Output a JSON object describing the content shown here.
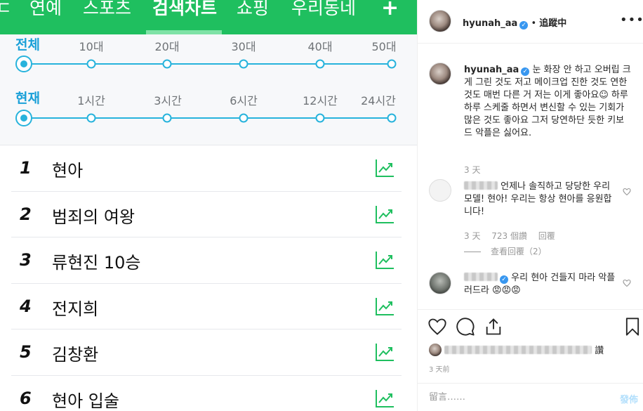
{
  "left": {
    "nav_tabs": [
      {
        "label": "ㄷ"
      },
      {
        "label": "연예"
      },
      {
        "label": "스포츠"
      },
      {
        "label": "검색차트"
      },
      {
        "label": "쇼핑"
      },
      {
        "label": "우리동네"
      },
      {
        "label": "+"
      }
    ],
    "age_filter": {
      "label": "전체",
      "options": [
        "10대",
        "20대",
        "30대",
        "40대",
        "50대"
      ]
    },
    "time_filter": {
      "label": "현재",
      "options": [
        "1시간",
        "3시간",
        "6시간",
        "12시간",
        "24시간"
      ]
    },
    "ranking": [
      {
        "rank": "1",
        "keyword": "현아"
      },
      {
        "rank": "2",
        "keyword": "범죄의 여왕"
      },
      {
        "rank": "3",
        "keyword": "류현진 10승"
      },
      {
        "rank": "4",
        "keyword": "전지희"
      },
      {
        "rank": "5",
        "keyword": "김창환"
      },
      {
        "rank": "6",
        "keyword": "현아 입술"
      }
    ],
    "colors": {
      "nav_green": "#1fbf5f",
      "accent_blue": "#27b3dc",
      "trend_green": "#1fbf5f"
    }
  },
  "post": {
    "username": "hyunah_aa",
    "follow_label": "追蹤中",
    "separator": "•",
    "caption": "눈 화장 안 하고 오버립 크게 그린 것도 저고 메이크업 진한 것도 연한 것도 매번 다른 거 저는 이게 좋아요☺︎ 하루하루 스케줄 하면서 변신할 수 있는 기회가 많은 것도 좋아요 그저 당연하단 듯한 키보드 악플은 싫어요.",
    "caption_time": "3 天",
    "comments": [
      {
        "text": "언제나 솔직하고 당당한 우리모델! 현아! 우리는 항상 현아를 응원합니다!",
        "time": "3 天",
        "likes": "723 個讚",
        "reply_label": "回覆",
        "view_replies": "查看回覆（2）"
      },
      {
        "text": "우리 현아 건들지 마라 악플러드라 😡😡😡"
      }
    ],
    "likes_suffix": "讚",
    "time": "3 天前",
    "comment_placeholder": "留言……",
    "post_button": "發佈"
  }
}
